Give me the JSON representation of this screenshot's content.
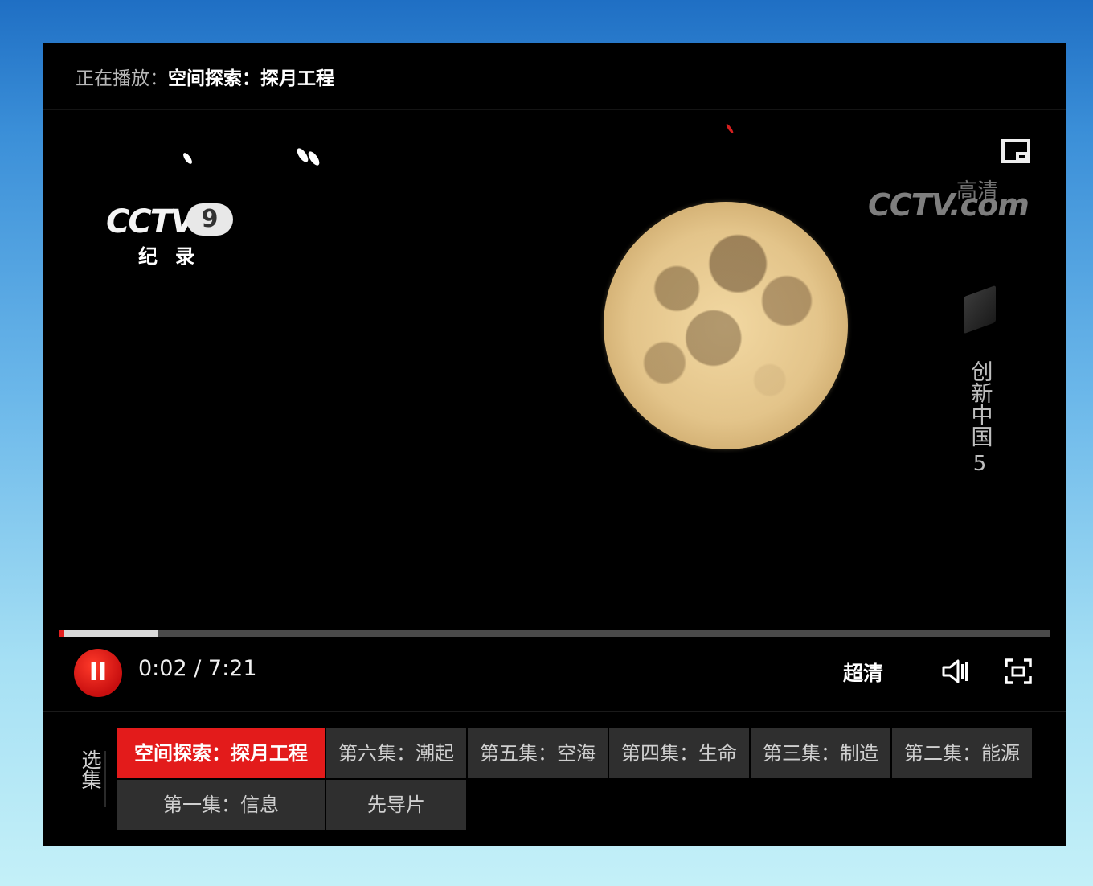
{
  "now_playing": {
    "label": "正在播放：",
    "title": "空间探索：探月工程"
  },
  "watermarks": {
    "channel_logo": "CCTV",
    "channel_number": "9",
    "channel_sub": "纪录",
    "site_logo": "CCTV.com",
    "site_tag": "高清",
    "series_chars": "创新中国",
    "series_number": "5"
  },
  "playback": {
    "progress": 0.005,
    "buffered": 0.095,
    "time": "0:02 / 7:21",
    "play_pause_glyph": "II",
    "quality": "超清"
  },
  "icons": {
    "pip": "picture-in-picture-icon",
    "play_pause": "pause-icon",
    "volume": "volume-icon",
    "fullscreen": "fullscreen-icon"
  },
  "episodes": {
    "label": "选集",
    "items": [
      {
        "label": "空间探索：探月工程",
        "active": true
      },
      {
        "label": "第六集：潮起",
        "active": false
      },
      {
        "label": "第五集：空海",
        "active": false
      },
      {
        "label": "第四集：生命",
        "active": false
      },
      {
        "label": "第三集：制造",
        "active": false
      },
      {
        "label": "第二集：能源",
        "active": false
      },
      {
        "label": "第一集：信息",
        "active": false
      },
      {
        "label": "先导片",
        "active": false
      }
    ]
  },
  "colors": {
    "accent": "#e31b1b",
    "tile": "#2f2f2f",
    "background": "#000000"
  }
}
